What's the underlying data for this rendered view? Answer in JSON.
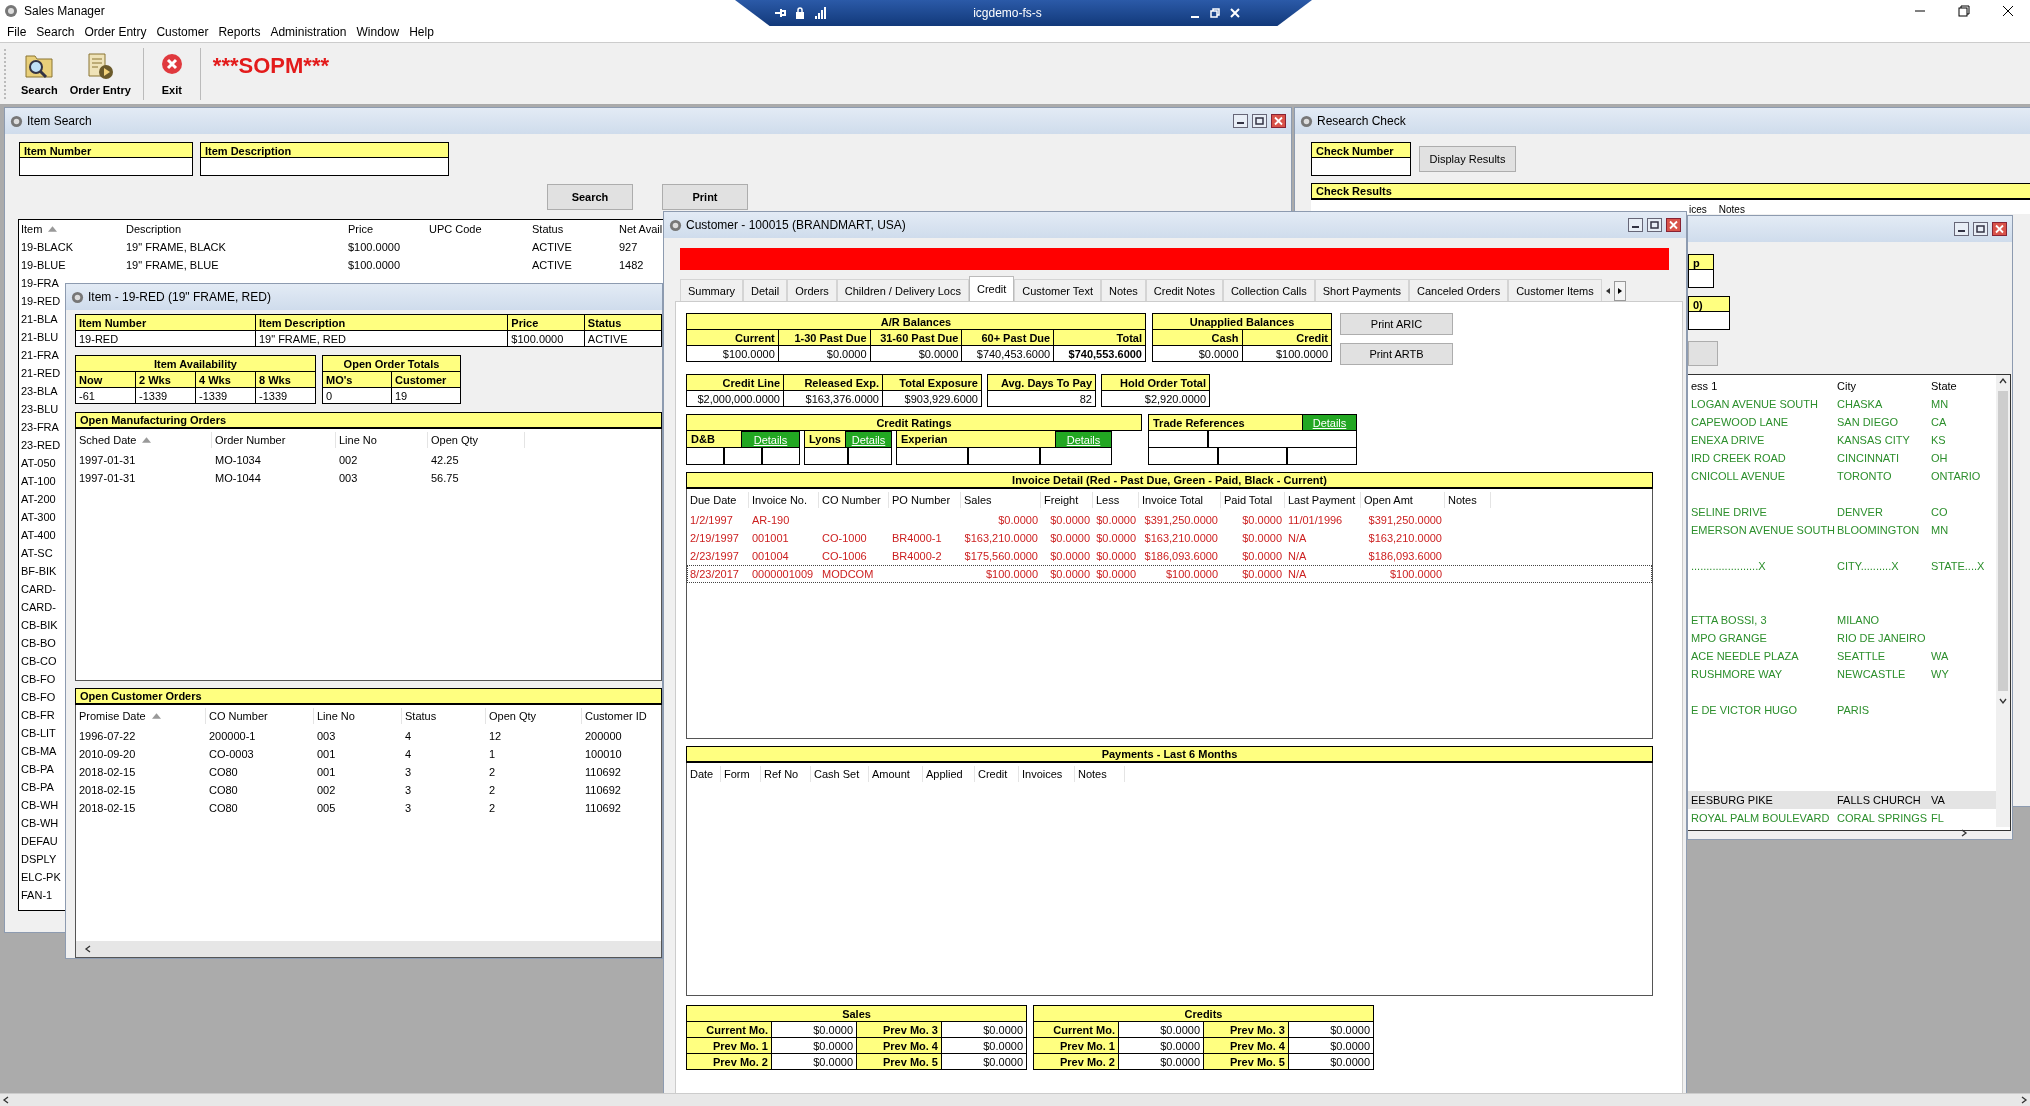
{
  "title_bar": {
    "title": "Sales Manager"
  },
  "remote_bar": {
    "host": "icgdemo-fs-s"
  },
  "menu": [
    "File",
    "Search",
    "Order Entry",
    "Customer",
    "Reports",
    "Administration",
    "Window",
    "Help"
  ],
  "toolbar": [
    {
      "label": "Search",
      "kind": "search"
    },
    {
      "label": "Order Entry",
      "kind": "order"
    },
    {
      "label": "Exit",
      "kind": "exit"
    }
  ],
  "banner": "***SOPM***",
  "item_search": {
    "title": "Item Search",
    "fields": [
      {
        "label": "Item Number"
      },
      {
        "label": "Item Description"
      }
    ],
    "buttons": [
      "Search",
      "Print"
    ],
    "columns": [
      "Item",
      "Description",
      "Price",
      "UPC Code",
      "Status",
      "Net Avail"
    ],
    "rows": [
      {
        "item": "19-BLACK",
        "description": "19\" FRAME, BLACK",
        "price": "$100.0000",
        "status": "ACTIVE",
        "net_avail": "927"
      },
      {
        "item": "19-BLUE",
        "description": "19\" FRAME, BLUE",
        "price": "$100.0000",
        "status": "ACTIVE",
        "net_avail": "1482"
      },
      {
        "item": "19-FRA"
      },
      {
        "item": "19-RED"
      },
      {
        "item": "21-BLA"
      },
      {
        "item": "21-BLU"
      },
      {
        "item": "21-FRA"
      },
      {
        "item": "21-RED"
      },
      {
        "item": "23-BLA"
      },
      {
        "item": "23-BLU"
      },
      {
        "item": "23-FRA"
      },
      {
        "item": "23-RED"
      },
      {
        "item": "AT-050"
      },
      {
        "item": "AT-100"
      },
      {
        "item": "AT-200"
      },
      {
        "item": "AT-300"
      },
      {
        "item": "AT-400"
      },
      {
        "item": "AT-SC"
      },
      {
        "item": "BF-BIK"
      },
      {
        "item": "CARD-"
      },
      {
        "item": "CARD-"
      },
      {
        "item": "CB-BIK"
      },
      {
        "item": "CB-BO"
      },
      {
        "item": "CB-CO"
      },
      {
        "item": "CB-FO"
      },
      {
        "item": "CB-FO"
      },
      {
        "item": "CB-FR"
      },
      {
        "item": "CB-LIT"
      },
      {
        "item": "CB-MA"
      },
      {
        "item": "CB-PA"
      },
      {
        "item": "CB-PA"
      },
      {
        "item": "CB-WH"
      },
      {
        "item": "CB-WH"
      },
      {
        "item": "DEFAU"
      },
      {
        "item": "DSPLY"
      },
      {
        "item": "ELC-PK"
      },
      {
        "item": "FAN-1"
      }
    ]
  },
  "item_window": {
    "title": "Item - 19-RED (19\" FRAME, RED)",
    "header": [
      {
        "label": "Item Number",
        "value": "19-RED"
      },
      {
        "label": "Item Description",
        "value": "19\" FRAME, RED"
      },
      {
        "label": "Price",
        "value": "$100.0000"
      },
      {
        "label": "Status",
        "value": "ACTIVE"
      }
    ],
    "availability": {
      "title": "Item Availability",
      "columns": [
        {
          "label": "Now",
          "value": "-61"
        },
        {
          "label": "2 Wks",
          "value": "-1339"
        },
        {
          "label": "4 Wks",
          "value": "-1339"
        },
        {
          "label": "8 Wks",
          "value": "-1339"
        }
      ]
    },
    "order_totals": {
      "title": "Open Order Totals",
      "columns": [
        {
          "label": "MO's",
          "value": "0"
        },
        {
          "label": "Customer",
          "value": "19"
        }
      ]
    },
    "manufacturing_orders": {
      "title": "Open Manufacturing Orders",
      "columns": [
        "Sched Date",
        "Order Number",
        "Line No",
        "Open Qty"
      ],
      "rows": [
        [
          "1997-01-31",
          "MO-1034",
          "002",
          "42.25"
        ],
        [
          "1997-01-31",
          "MO-1044",
          "003",
          "56.75"
        ]
      ]
    },
    "customer_orders": {
      "title": "Open Customer Orders",
      "columns": [
        "Promise Date",
        "CO Number",
        "Line No",
        "Status",
        "Open Qty",
        "Customer ID"
      ],
      "rows": [
        [
          "1996-07-22",
          "200000-1",
          "003",
          "4",
          "12",
          "200000"
        ],
        [
          "2010-09-20",
          "CO-0003",
          "001",
          "4",
          "1",
          "100010"
        ],
        [
          "2018-02-15",
          "CO80",
          "001",
          "3",
          "2",
          "110692"
        ],
        [
          "2018-02-15",
          "CO80",
          "002",
          "3",
          "2",
          "110692"
        ],
        [
          "2018-02-15",
          "CO80",
          "005",
          "3",
          "2",
          "110692"
        ]
      ]
    }
  },
  "customer_window": {
    "title": "Customer - 100015 (BRANDMART, USA)",
    "tabs": [
      {
        "label": "Summary",
        "selected": false
      },
      {
        "label": "Detail",
        "selected": false
      },
      {
        "label": "Orders",
        "selected": false
      },
      {
        "label": "Children / Delivery Locs",
        "selected": false
      },
      {
        "label": "Credit",
        "selected": true
      },
      {
        "label": "Customer Text",
        "selected": false
      },
      {
        "label": "Notes",
        "selected": false
      },
      {
        "label": "Credit Notes",
        "selected": false
      },
      {
        "label": "Collection Calls",
        "selected": false
      },
      {
        "label": "Short Payments",
        "selected": false
      },
      {
        "label": "Canceled Orders",
        "selected": false
      },
      {
        "label": "Customer Items",
        "selected": false
      }
    ],
    "ar_balances": {
      "title": "A/R Balances",
      "columns": [
        {
          "label": "Current",
          "value": "$100.0000",
          "bold": false
        },
        {
          "label": "1-30 Past Due",
          "value": "$0.0000",
          "bold": false
        },
        {
          "label": "31-60 Past Due",
          "value": "$0.0000",
          "bold": false
        },
        {
          "label": "60+ Past Due",
          "value": "$740,453.6000",
          "bold": false
        },
        {
          "label": "Total",
          "value": "$740,553.6000",
          "bold": true
        }
      ]
    },
    "unapplied_balances": {
      "title": "Unapplied Balances",
      "columns": [
        {
          "label": "Cash",
          "value": "$0.0000"
        },
        {
          "label": "Credit",
          "value": "$100.0000"
        }
      ]
    },
    "print_buttons": [
      "Print ARIC",
      "Print ARTB"
    ],
    "exposure": [
      {
        "fields": [
          {
            "label": "Credit Line",
            "value": "$2,000,000.0000"
          },
          {
            "label": "Released Exp.",
            "value": "$163,376.0000"
          },
          {
            "label": "Total Exposure",
            "value": "$903,929.6000"
          }
        ]
      },
      {
        "fields": [
          {
            "label": "Avg. Days To Pay",
            "value": "82"
          }
        ]
      },
      {
        "fields": [
          {
            "label": "Hold Order Total",
            "value": "$2,920.0000"
          }
        ]
      }
    ],
    "credit_ratings": {
      "title": "Credit Ratings",
      "agencies": [
        {
          "name": "D&B",
          "link": "Details"
        },
        {
          "name": "Lyons",
          "link": "Details"
        },
        {
          "name": "Experian",
          "link": "Details"
        }
      ]
    },
    "trade_references": {
      "title": "Trade References",
      "link": "Details"
    },
    "invoice_detail": {
      "title": "Invoice Detail (Red - Past Due, Green - Paid, Black - Current)",
      "columns": [
        "Due Date",
        "Invoice No.",
        "CO Number",
        "PO Number",
        "Sales",
        "Freight",
        "Less",
        "Invoice Total",
        "Paid Total",
        "Last Payment",
        "Open Amt",
        "Notes"
      ],
      "rows": [
        {
          "kind": "past_due",
          "selected": false,
          "cells": [
            "1/2/1997",
            "AR-190",
            null,
            null,
            "$0.0000",
            "$0.0000",
            "$0.0000",
            "$391,250.0000",
            "$0.0000",
            "11/01/1996",
            "$391,250.0000",
            null
          ]
        },
        {
          "kind": "past_due",
          "selected": false,
          "cells": [
            "2/19/1997",
            "001001",
            "CO-1000",
            "BR4000-1",
            "$163,210.0000",
            "$0.0000",
            "$0.0000",
            "$163,210.0000",
            "$0.0000",
            "N/A",
            "$163,210.0000",
            null
          ]
        },
        {
          "kind": "past_due",
          "selected": false,
          "cells": [
            "2/23/1997",
            "001004",
            "CO-1006",
            "BR4000-2",
            "$175,560.0000",
            "$0.0000",
            "$0.0000",
            "$186,093.6000",
            "$0.0000",
            "N/A",
            "$186,093.6000",
            null
          ]
        },
        {
          "kind": "past_due",
          "selected": true,
          "cells": [
            "8/23/2017",
            "0000001009",
            "MODCOM",
            null,
            "$100.0000",
            "$0.0000",
            "$0.0000",
            "$100.0000",
            "$0.0000",
            "N/A",
            "$100.0000",
            null
          ]
        }
      ]
    },
    "payments": {
      "title": "Payments - Last 6 Months",
      "columns": [
        "Date",
        "Form",
        "Ref No",
        "Cash Set",
        "Amount",
        "Applied",
        "Credit",
        "Invoices",
        "Notes"
      ]
    },
    "summaries": [
      {
        "title": "Sales",
        "rows": [
          [
            {
              "label": "Current Mo.",
              "value": "$0.0000"
            },
            {
              "label": "Prev Mo. 3",
              "value": "$0.0000"
            }
          ],
          [
            {
              "label": "Prev Mo. 1",
              "value": "$0.0000"
            },
            {
              "label": "Prev Mo. 4",
              "value": "$0.0000"
            }
          ],
          [
            {
              "label": "Prev Mo. 2",
              "value": "$0.0000"
            },
            {
              "label": "Prev Mo. 5",
              "value": "$0.0000"
            }
          ]
        ]
      },
      {
        "title": "Credits",
        "rows": [
          [
            {
              "label": "Current Mo.",
              "value": "$0.0000"
            },
            {
              "label": "Prev Mo. 3",
              "value": "$0.0000"
            }
          ],
          [
            {
              "label": "Prev Mo. 1",
              "value": "$0.0000"
            },
            {
              "label": "Prev Mo. 4",
              "value": "$0.0000"
            }
          ],
          [
            {
              "label": "Prev Mo. 2",
              "value": "$0.0000"
            },
            {
              "label": "Prev Mo. 5",
              "value": "$0.0000"
            }
          ]
        ]
      }
    ]
  },
  "research_check": {
    "title": "Research Check",
    "field": {
      "label": "Check Number"
    },
    "button": "Display Results",
    "results": {
      "title": "Check Results",
      "columns": [
        "ices",
        "Notes"
      ]
    }
  },
  "address_window": {
    "labels": [
      "p",
      "0)"
    ],
    "columns": [
      "ess 1",
      "City",
      "State"
    ],
    "rows": [
      {
        "kind": "address",
        "selected": false,
        "cells": [
          "LOGAN AVENUE SOUTH",
          "CHASKA",
          "MN"
        ]
      },
      {
        "kind": "address",
        "selected": false,
        "cells": [
          "CAPEWOOD LANE",
          "SAN DIEGO",
          "CA"
        ]
      },
      {
        "kind": "address",
        "selected": false,
        "cells": [
          "ENEXA DRIVE",
          "KANSAS CITY",
          "KS"
        ]
      },
      {
        "kind": "address",
        "selected": false,
        "cells": [
          "IRD CREEK ROAD",
          "CINCINNATI",
          "OH"
        ]
      },
      {
        "kind": "address",
        "selected": false,
        "cells": [
          "CNICOLL AVENUE",
          "TORONTO",
          "ONTARIO"
        ]
      },
      {
        "kind": "blank"
      },
      {
        "kind": "address",
        "selected": false,
        "cells": [
          "SELINE DRIVE",
          "DENVER",
          "CO"
        ]
      },
      {
        "kind": "address",
        "selected": false,
        "cells": [
          "EMERSON AVENUE SOUTH",
          "BLOOMINGTON",
          "MN"
        ]
      },
      {
        "kind": "blank"
      },
      {
        "kind": "address",
        "selected": false,
        "cells": [
          "......................X",
          "CITY..........X",
          "STATE....X"
        ]
      },
      {
        "kind": "blank"
      },
      {
        "kind": "blank"
      },
      {
        "kind": "address",
        "selected": false,
        "cells": [
          "ETTA BOSSI, 3",
          "MILANO",
          null
        ]
      },
      {
        "kind": "address",
        "selected": false,
        "cells": [
          "MPO GRANGE",
          "RIO DE JANEIRO",
          null
        ]
      },
      {
        "kind": "address",
        "selected": false,
        "cells": [
          "ACE NEEDLE PLAZA",
          "SEATTLE",
          "WA"
        ]
      },
      {
        "kind": "address",
        "selected": false,
        "cells": [
          "RUSHMORE WAY",
          "NEWCASTLE",
          "WY"
        ]
      },
      {
        "kind": "blank"
      },
      {
        "kind": "address",
        "selected": false,
        "cells": [
          "E DE VICTOR HUGO",
          "PARIS",
          null
        ]
      },
      {
        "kind": "blank"
      },
      {
        "kind": "blank"
      },
      {
        "kind": "blank"
      },
      {
        "kind": "blank"
      },
      {
        "kind": "address",
        "selected": true,
        "cells": [
          "EESBURG PIKE",
          "FALLS CHURCH",
          "VA"
        ]
      },
      {
        "kind": "address",
        "selected": false,
        "cells": [
          "ROYAL PALM BOULEVARD",
          "CORAL SPRINGS",
          "FL"
        ]
      }
    ]
  }
}
